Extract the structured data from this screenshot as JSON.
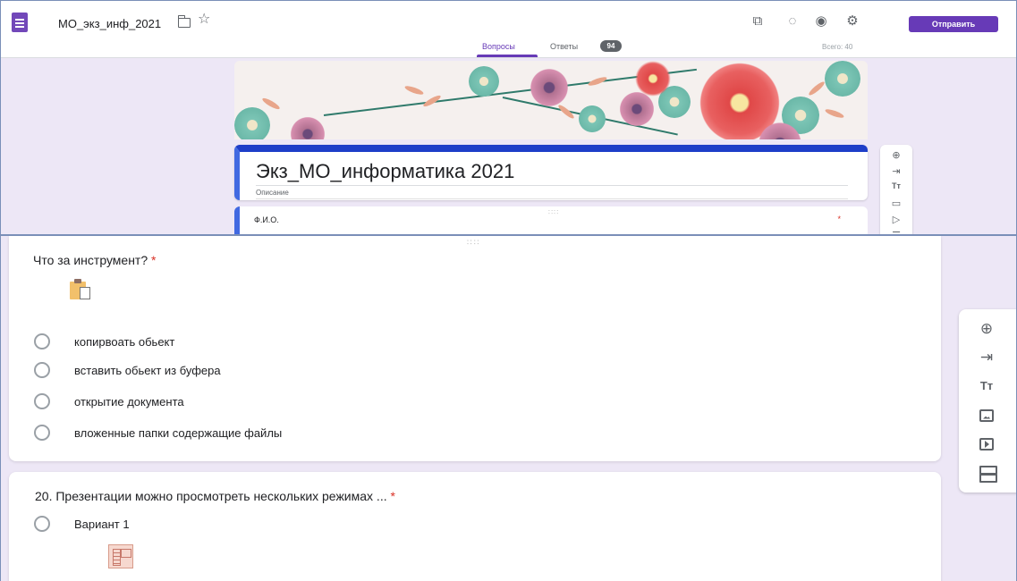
{
  "header": {
    "doc_title": "МО_экз_инф_2021",
    "send_label": "Отправить",
    "icons": [
      "addon-icon",
      "palette-icon",
      "preview-icon",
      "settings-icon"
    ]
  },
  "tabs": {
    "questions": "Вопросы",
    "responses": "Ответы",
    "responses_count": "94",
    "total": "Всего: 40"
  },
  "form": {
    "title": "Экз_МО_информатика 2021",
    "description": "Описание",
    "fio_label": "Ф.И.О.",
    "required_mark": "*"
  },
  "question1": {
    "title": "Что за инструмент?",
    "required_mark": "*",
    "options": [
      "копирвоать обьект",
      "вставить обьект из буфера",
      "открытие документа",
      "вложенные папки содержащие файлы"
    ]
  },
  "question2": {
    "title": "20. Презентации можно просмотреть нескольких режимах ...",
    "required_mark": "*",
    "option1": "Вариант 1"
  },
  "toolbar": {
    "items": [
      "add-question-icon",
      "import-questions-icon",
      "add-title-icon",
      "add-image-icon",
      "add-video-icon",
      "add-section-icon"
    ],
    "title_glyph": "Tт"
  },
  "colors": {
    "accent": "#673ab7",
    "title_border": "#1e3ec8",
    "background": "#ede7f6",
    "required": "#d93025"
  }
}
